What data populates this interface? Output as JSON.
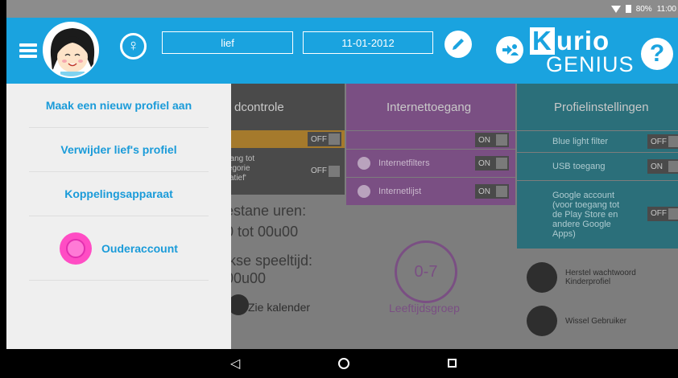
{
  "statusbar": {
    "battery": "80%",
    "time": "11:00"
  },
  "header": {
    "name_value": "lief",
    "date_value": "11-01-2012",
    "logo_line1_k": "K",
    "logo_line1_rest": "urio",
    "logo_line2": "GENIUS",
    "help_label": "?",
    "gender_symbol": "♀"
  },
  "drawer": {
    "items": [
      {
        "label": "Maak een nieuw profiel aan"
      },
      {
        "label": "Verwijder lief's profiel"
      },
      {
        "label": "Koppelingsapparaat"
      },
      {
        "label": "Ouderaccount"
      }
    ]
  },
  "background": {
    "col1": {
      "head": "dcontrole",
      "toggle1": "OFF",
      "row2_lines": [
        "gang tot",
        "tegorie",
        "catief'"
      ],
      "toggle2": "OFF",
      "line1": "estane uren:",
      "line2": "0 tot 00u00",
      "line3": "jkse speeltijd:",
      "line4": "00u00",
      "calendar": "Zie kalender"
    },
    "col2": {
      "head": "Internettoegang",
      "toggle1": "ON",
      "filters_label": "Internetfilters",
      "filters_toggle": "ON",
      "list_label": "Internetlijst",
      "list_toggle": "ON",
      "age_value": "0-7",
      "age_label": "Leeftijdsgroep"
    },
    "col3": {
      "head": "Profielinstellingen",
      "blue_light": "Blue light filter",
      "blue_light_toggle": "OFF",
      "usb": "USB toegang",
      "usb_toggle": "ON",
      "google": "Google account (voor toegang tot de Play Store en andere Google Apps)",
      "google_toggle": "OFF",
      "reset_pw": "Herstel wachtwoord Kinderprofiel",
      "switch_user": "Wissel Gebruiker"
    }
  },
  "navbar": {
    "back": "◁"
  },
  "colors": {
    "accent": "#1aa3df",
    "menu_text": "#1a9bd9",
    "pink": "#ff4dc4",
    "purple": "#7a4f83",
    "teal": "#2b6f7a"
  }
}
